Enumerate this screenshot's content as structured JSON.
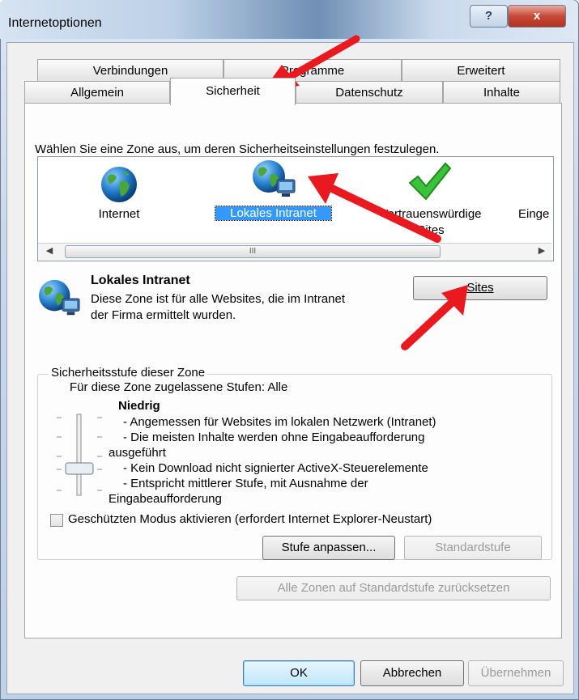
{
  "window": {
    "title": "Internetoptionen",
    "help_label": "?",
    "close_label": "x"
  },
  "tabs": {
    "row1": [
      "Verbindungen",
      "Programme",
      "Erweitert"
    ],
    "row2": [
      "Allgemein",
      "Sicherheit",
      "Datenschutz",
      "Inhalte"
    ],
    "active": "Sicherheit"
  },
  "zones": {
    "prompt": "Wählen Sie eine Zone aus, um deren Sicherheitseinstellungen festzulegen.",
    "items": [
      {
        "label": "Internet",
        "icon": "globe-icon"
      },
      {
        "label": "Lokales Intranet",
        "icon": "intranet-globe-icon",
        "selected": true
      },
      {
        "label_line1": "Vertrauenswürdige",
        "label_line2": "Sites",
        "icon": "checkmark-icon"
      },
      {
        "label": "Einge",
        "icon": "restricted-icon"
      }
    ],
    "scroll_mark": "III"
  },
  "selected_zone": {
    "title": "Lokales Intranet",
    "description_line1": "Diese Zone ist für alle Websites, die im Intranet",
    "description_line2": "der Firma ermittelt wurden.",
    "sites_button": "Sites"
  },
  "security_level": {
    "group_label": "Sicherheitsstufe dieser Zone",
    "allowed_levels": "Für diese Zone zugelassene Stufen: Alle",
    "level_name": "Niedrig",
    "lines": [
      "- Angemessen für Websites im lokalen Netzwerk (Intranet)",
      "- Die meisten Inhalte werden ohne Eingabeaufforderung",
      "ausgeführt",
      "- Kein Download nicht signierter ActiveX-Steuerelemente",
      "- Entspricht mittlerer Stufe, mit Ausnahme der",
      "Eingabeaufforderung"
    ],
    "slider_level": "Niedrig",
    "protected_mode_label": "Geschützten Modus aktivieren (erfordert Internet Explorer-Neustart)",
    "protected_mode_checked": false,
    "custom_level_button": "Stufe anpassen...",
    "default_level_button": "Standardstufe"
  },
  "reset_all_button": "Alle Zonen auf Standardstufe zurücksetzen",
  "footer": {
    "ok": "OK",
    "cancel": "Abbrechen",
    "apply": "Übernehmen"
  },
  "colors": {
    "selection": "#3399ff",
    "annotation_arrow": "#e8191f"
  }
}
